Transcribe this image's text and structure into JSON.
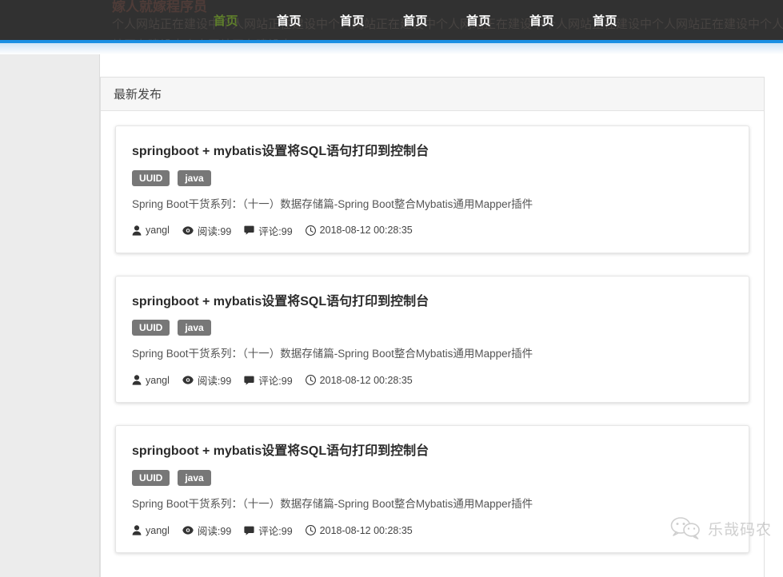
{
  "header": {
    "hero_title": "嫁人就嫁程序员",
    "hero_body": "个人网站正在建设中个人网站正在建设中个人网站正在建设中个人网站正在建设中个人网站正在建设中个人网站正在建设中个人网站正在建设中个人网站正在建设中。。。",
    "accent_color": "#1a8fe3",
    "active_color": "#5f7f2c",
    "nav": [
      {
        "label": "首页",
        "active": true
      },
      {
        "label": "首页",
        "active": false
      },
      {
        "label": "首页",
        "active": false
      },
      {
        "label": "首页",
        "active": false
      },
      {
        "label": "首页",
        "active": false
      },
      {
        "label": "首页",
        "active": false
      },
      {
        "label": "首页",
        "active": false
      }
    ]
  },
  "panel": {
    "title": "最新发布"
  },
  "articles": [
    {
      "title": "springboot + mybatis设置将SQL语句打印到控制台",
      "tags": [
        "UUID",
        "java"
      ],
      "desc": "Spring Boot干货系列：（十一）数据存储篇-Spring Boot整合Mybatis通用Mapper插件",
      "author": "yangl",
      "views": "阅读:99",
      "comments": "评论:99",
      "date": "2018-08-12 00:28:35"
    },
    {
      "title": "springboot + mybatis设置将SQL语句打印到控制台",
      "tags": [
        "UUID",
        "java"
      ],
      "desc": "Spring Boot干货系列：（十一）数据存储篇-Spring Boot整合Mybatis通用Mapper插件",
      "author": "yangl",
      "views": "阅读:99",
      "comments": "评论:99",
      "date": "2018-08-12 00:28:35"
    },
    {
      "title": "springboot + mybatis设置将SQL语句打印到控制台",
      "tags": [
        "UUID",
        "java"
      ],
      "desc": "Spring Boot干货系列：（十一）数据存储篇-Spring Boot整合Mybatis通用Mapper插件",
      "author": "yangl",
      "views": "阅读:99",
      "comments": "评论:99",
      "date": "2018-08-12 00:28:35"
    }
  ],
  "watermark": {
    "label": "乐哉码农",
    "icon": "wechat-icon"
  }
}
